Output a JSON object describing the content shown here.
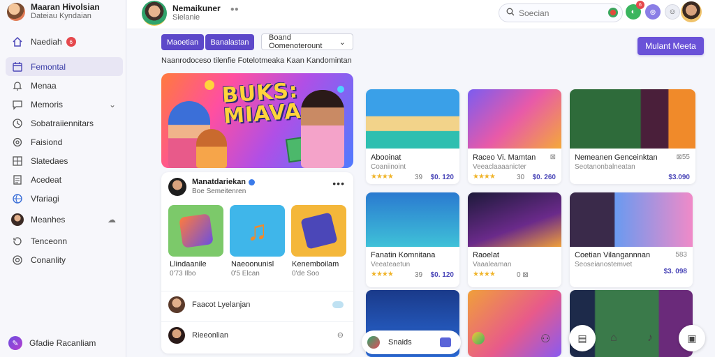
{
  "sidebar": {
    "profile_name": "Maaran Hivolsian",
    "profile_sub": "Dateiau Kyndaian",
    "items": [
      {
        "label": "Naediah",
        "icon": "home-icon",
        "badge": "6"
      },
      {
        "label": "Femontal",
        "icon": "calendar-icon",
        "active": true
      },
      {
        "label": "Menaa",
        "icon": "bell-icon"
      },
      {
        "label": "Memoris",
        "icon": "chat-icon",
        "chevron": true
      },
      {
        "label": "Sobatraiiennitars",
        "icon": "clock-icon"
      },
      {
        "label": "Faisiond",
        "icon": "settings-icon"
      },
      {
        "label": "Slatedaes",
        "icon": "grid-icon"
      },
      {
        "label": "Acedeat",
        "icon": "document-icon"
      },
      {
        "label": "Vfariagi",
        "icon": "globe-icon"
      },
      {
        "label": "Meanhes",
        "icon": "avatar-icon",
        "right_icon": "cloud-icon"
      },
      {
        "label": "Tenceonn",
        "icon": "history-icon"
      },
      {
        "label": "Conanlity",
        "icon": "target-icon"
      }
    ],
    "footer": "Gfadie Racanliam"
  },
  "topbar": {
    "name": "Nemaikuner",
    "sub": "Sielanie",
    "search_placeholder": "Soecian",
    "badge_green": "6",
    "badge_red": ""
  },
  "filters": {
    "chip1": "Maoetian",
    "chip2": "Banalastan",
    "dropdown": "Boand Oomenoterount",
    "main_button": "Mulant Meeta"
  },
  "subtitle": "Naanrodoceso tilenfie Fotelotmeaka Kaan Kandomintan",
  "hero": {
    "title_line1": "BUKS:",
    "title_line2": "MIAVA"
  },
  "panel": {
    "name": "Manatdariekan",
    "sub": "Boe Semeitenren",
    "tiles": [
      {
        "label": "Llindaanile",
        "sub": "0'73 Ilbo"
      },
      {
        "label": "Naeoonunisl",
        "sub": "0'5 Elcan"
      },
      {
        "label": "Kenemboilam",
        "sub": "0'de Soo"
      }
    ],
    "rows": [
      {
        "label": "Faacot Lyelanjan"
      },
      {
        "label": "Rieeonlian"
      }
    ]
  },
  "cards": [
    {
      "title": "Abooinat",
      "sub": "Coaniinoint",
      "flag": "",
      "count": "39",
      "price": "$0. 120",
      "stars": "★★★★"
    },
    {
      "title": "Raceo Vi. Mamtan",
      "sub": "Veeaclaaaanicter",
      "flag": "⊠",
      "count": "30",
      "price": "$0. 260",
      "stars": "★★★★"
    },
    {
      "title": "Nemeanen Genceinktan",
      "sub": "Seotanonbalneatan",
      "flag": "⊠55",
      "count": "",
      "price": "$3.090",
      "stars": ""
    },
    {
      "title": "Fanatin Komnitana",
      "sub": "Veeateaetun",
      "flag": "",
      "count": "39",
      "price": "$0. 120",
      "stars": "★★★★"
    },
    {
      "title": "Raoelat",
      "sub": "Vaaaleaman",
      "flag": "",
      "count": "0 ⊠",
      "price": "",
      "stars": "★★★★"
    },
    {
      "title": "Coetian Vilangannnan",
      "sub": "Seoseianostemvet",
      "flag": "583",
      "count": "",
      "price": "$3. 098",
      "stars": ""
    }
  ],
  "dock": {
    "label": "Snaids"
  }
}
